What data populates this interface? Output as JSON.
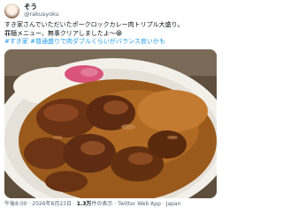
{
  "user": {
    "display_name": "そう",
    "handle": "@rakusyoku"
  },
  "tweet": {
    "line1": "すき家さんでいただいたポークロックカレー肉トリプル大盛り。",
    "line2": "罪麺メニュー、無事クリアしましたよ〜😁",
    "hashtags": [
      "#すき家",
      "#普通盛りで肉ダブルくらいがバランス良いかも"
    ]
  },
  "footer": {
    "time": "午後8:00",
    "sep1": "·",
    "date": "2026年8月23日",
    "sep2": "·",
    "views_count": "1.3万",
    "views_label": "件の表示",
    "sep3": "·",
    "source": "Twitter Web App",
    "sep4": "·",
    "location": "Japan"
  },
  "photo": {
    "subject": "curry-plate"
  }
}
